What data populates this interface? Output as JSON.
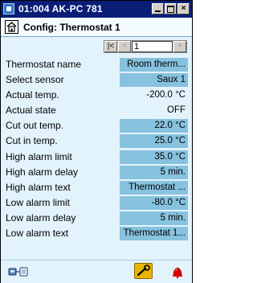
{
  "window": {
    "title": "01:004 AK-PC 781",
    "min_glyph": "",
    "max_glyph": "",
    "close_glyph": "×"
  },
  "header": {
    "title": "Config: Thermostat 1",
    "home_icon": "home-icon"
  },
  "navigator": {
    "first": "|<",
    "prev": "<",
    "value": "1",
    "next": "+"
  },
  "rows": [
    {
      "label": "Thermostat name",
      "value": "Room therm...",
      "editable": true
    },
    {
      "label": "Select sensor",
      "value": "Saux 1",
      "editable": true
    },
    {
      "label": "Actual temp.",
      "value": "-200.0 °C",
      "editable": false
    },
    {
      "label": "Actual state",
      "value": "OFF",
      "editable": false
    },
    {
      "label": "Cut out temp.",
      "value": "22.0 °C",
      "editable": true
    },
    {
      "label": "Cut in temp.",
      "value": "25.0 °C",
      "editable": true
    },
    {
      "label": "High alarm limit",
      "value": "35.0 °C",
      "editable": true
    },
    {
      "label": "High alarm delay",
      "value": "5 min.",
      "editable": true
    },
    {
      "label": "High alarm text",
      "value": "Thermostat ...",
      "editable": true
    },
    {
      "label": "Low alarm limit",
      "value": "-80.0 °C",
      "editable": true
    },
    {
      "label": "Low alarm delay",
      "value": "5 min.",
      "editable": true
    },
    {
      "label": "Low alarm text",
      "value": "Thermostat 1...",
      "editable": true
    }
  ],
  "colors": {
    "title_bar": "#0a1e78",
    "background": "#e3f3fc",
    "editable_field": "#87c2df",
    "alarm": "#e00000"
  }
}
